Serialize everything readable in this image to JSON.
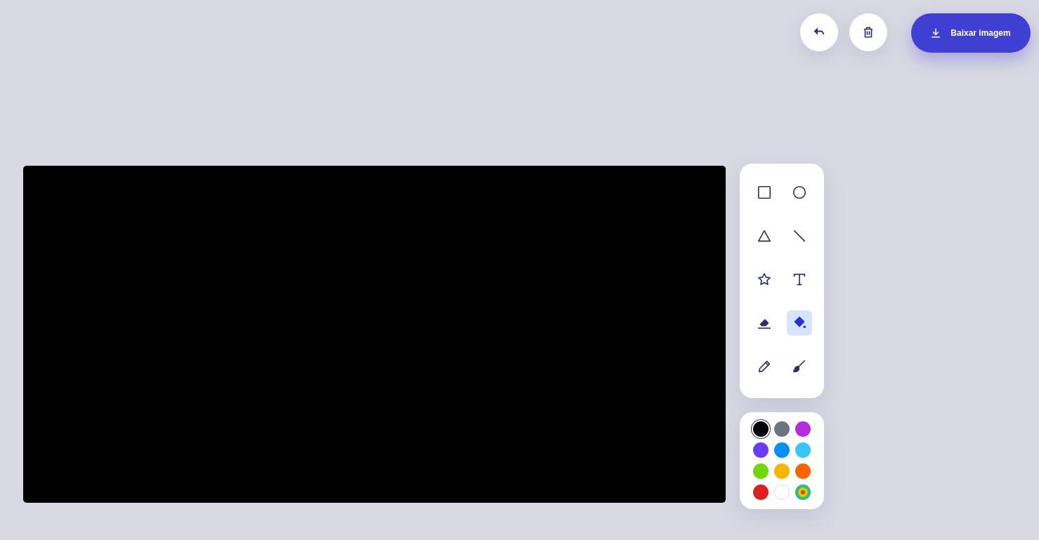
{
  "actions": [
    {
      "kind": "undo"
    },
    {
      "kind": "delete"
    },
    {
      "kind": "download",
      "label": "Baixar imagem"
    }
  ],
  "tools": [
    {
      "kind": "rectangle",
      "selected": false
    },
    {
      "kind": "circle",
      "selected": false
    },
    {
      "kind": "triangle",
      "selected": false
    },
    {
      "kind": "line",
      "selected": false
    },
    {
      "kind": "star",
      "selected": false
    },
    {
      "kind": "text",
      "selected": false
    },
    {
      "kind": "eraser",
      "selected": false
    },
    {
      "kind": "fill",
      "selected": true
    },
    {
      "kind": "pencil",
      "selected": false
    },
    {
      "kind": "brush",
      "selected": false
    }
  ],
  "colors": [
    {
      "kind": "swatch",
      "color": "#000000",
      "selected": true
    },
    {
      "kind": "swatch",
      "color": "#6c757d",
      "selected": false
    },
    {
      "kind": "swatch",
      "color": "#b52ce0",
      "selected": false
    },
    {
      "kind": "swatch",
      "color": "#6a3cff",
      "selected": false
    },
    {
      "kind": "swatch",
      "color": "#0090ff",
      "selected": false
    },
    {
      "kind": "swatch",
      "color": "#36c5ff",
      "selected": false
    },
    {
      "kind": "swatch",
      "color": "#72d600",
      "selected": false
    },
    {
      "kind": "swatch",
      "color": "#f8b500",
      "selected": false
    },
    {
      "kind": "swatch",
      "color": "#fa6400",
      "selected": false
    },
    {
      "kind": "swatch",
      "color": "#e02020",
      "selected": false
    },
    {
      "kind": "swatch",
      "color": "#ffffff",
      "selected": false
    },
    {
      "kind": "custom",
      "selected": false
    }
  ]
}
